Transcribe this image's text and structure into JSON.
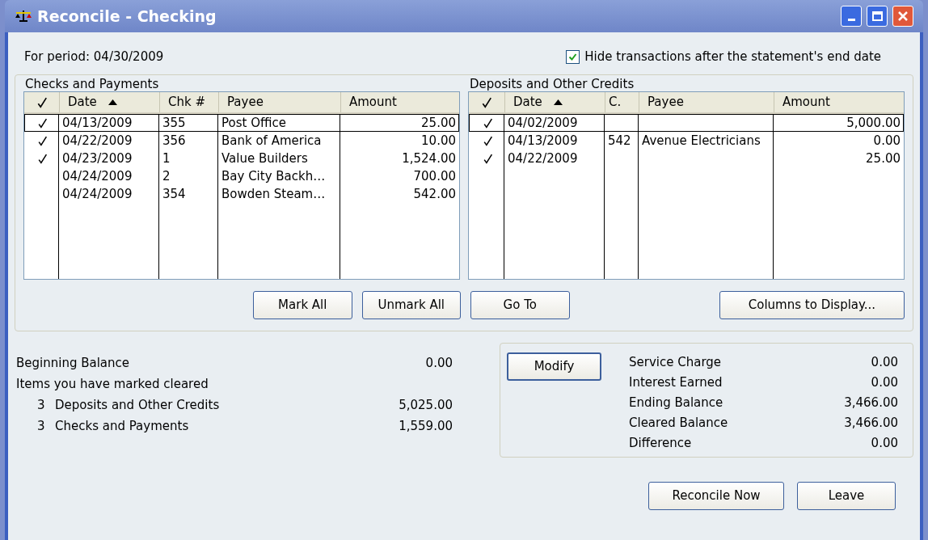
{
  "window": {
    "title": "Reconcile - Checking"
  },
  "period": "For period: 04/30/2009",
  "hide_after_end": {
    "label": "Hide transactions after the statement's end date",
    "checked": true
  },
  "checks_and_payments": {
    "title": "Checks and Payments",
    "columns": [
      {
        "label": "Date",
        "sorted": true
      },
      {
        "label": "Chk #",
        "sorted": false
      },
      {
        "label": "Payee",
        "sorted": false
      },
      {
        "label": "Amount",
        "sorted": false
      }
    ],
    "rows": [
      {
        "cleared": true,
        "selected": true,
        "date": "04/13/2009",
        "number": "355",
        "payee": "Post Office",
        "amount": "25.00"
      },
      {
        "cleared": true,
        "selected": false,
        "date": "04/22/2009",
        "number": "356",
        "payee": "Bank of America",
        "amount": "10.00"
      },
      {
        "cleared": true,
        "selected": false,
        "date": "04/23/2009",
        "number": "1",
        "payee": "Value Builders",
        "amount": "1,524.00"
      },
      {
        "cleared": false,
        "selected": false,
        "date": "04/24/2009",
        "number": "2",
        "payee": "Bay City Backh…",
        "amount": "700.00"
      },
      {
        "cleared": false,
        "selected": false,
        "date": "04/24/2009",
        "number": "354",
        "payee": "Bowden Steam…",
        "amount": "542.00"
      }
    ]
  },
  "deposits_and_credits": {
    "title": "Deposits and Other Credits",
    "columns": [
      {
        "label": "Date",
        "sorted": true
      },
      {
        "label": "C.",
        "sorted": false
      },
      {
        "label": "Payee",
        "sorted": false
      },
      {
        "label": "Amount",
        "sorted": false
      }
    ],
    "rows": [
      {
        "cleared": true,
        "selected": true,
        "date": "04/02/2009",
        "amount": "5,000.00"
      },
      {
        "cleared": true,
        "selected": false,
        "date": "04/13/2009",
        "number": "542",
        "payee": "Avenue Electricians",
        "amount": "0.00"
      },
      {
        "cleared": true,
        "selected": false,
        "date": "04/22/2009",
        "amount": "25.00"
      }
    ]
  },
  "list_buttons": [
    "Mark All",
    "Unmark All",
    "Go To",
    "Columns to Display..."
  ],
  "summary": [
    {
      "kind": "line",
      "label": "Beginning Balance",
      "value": "0.00"
    },
    {
      "kind": "heading",
      "label": "Items you have marked cleared"
    },
    {
      "kind": "count",
      "count": "3",
      "label": "Deposits and Other Credits",
      "value": "5,025.00"
    },
    {
      "kind": "count",
      "count": "3",
      "label": "Checks and Payments",
      "value": "1,559.00"
    }
  ],
  "statement": {
    "modify": "Modify",
    "rows": [
      {
        "label": "Service Charge",
        "value": "0.00"
      },
      {
        "label": "Interest Earned",
        "value": "0.00"
      },
      {
        "label": "Ending Balance",
        "value": "3,466.00"
      },
      {
        "label": "Cleared Balance",
        "value": "3,466.00"
      },
      {
        "label": "Difference",
        "value": "0.00"
      }
    ]
  },
  "footer_buttons": [
    "Reconcile Now",
    "Leave"
  ]
}
